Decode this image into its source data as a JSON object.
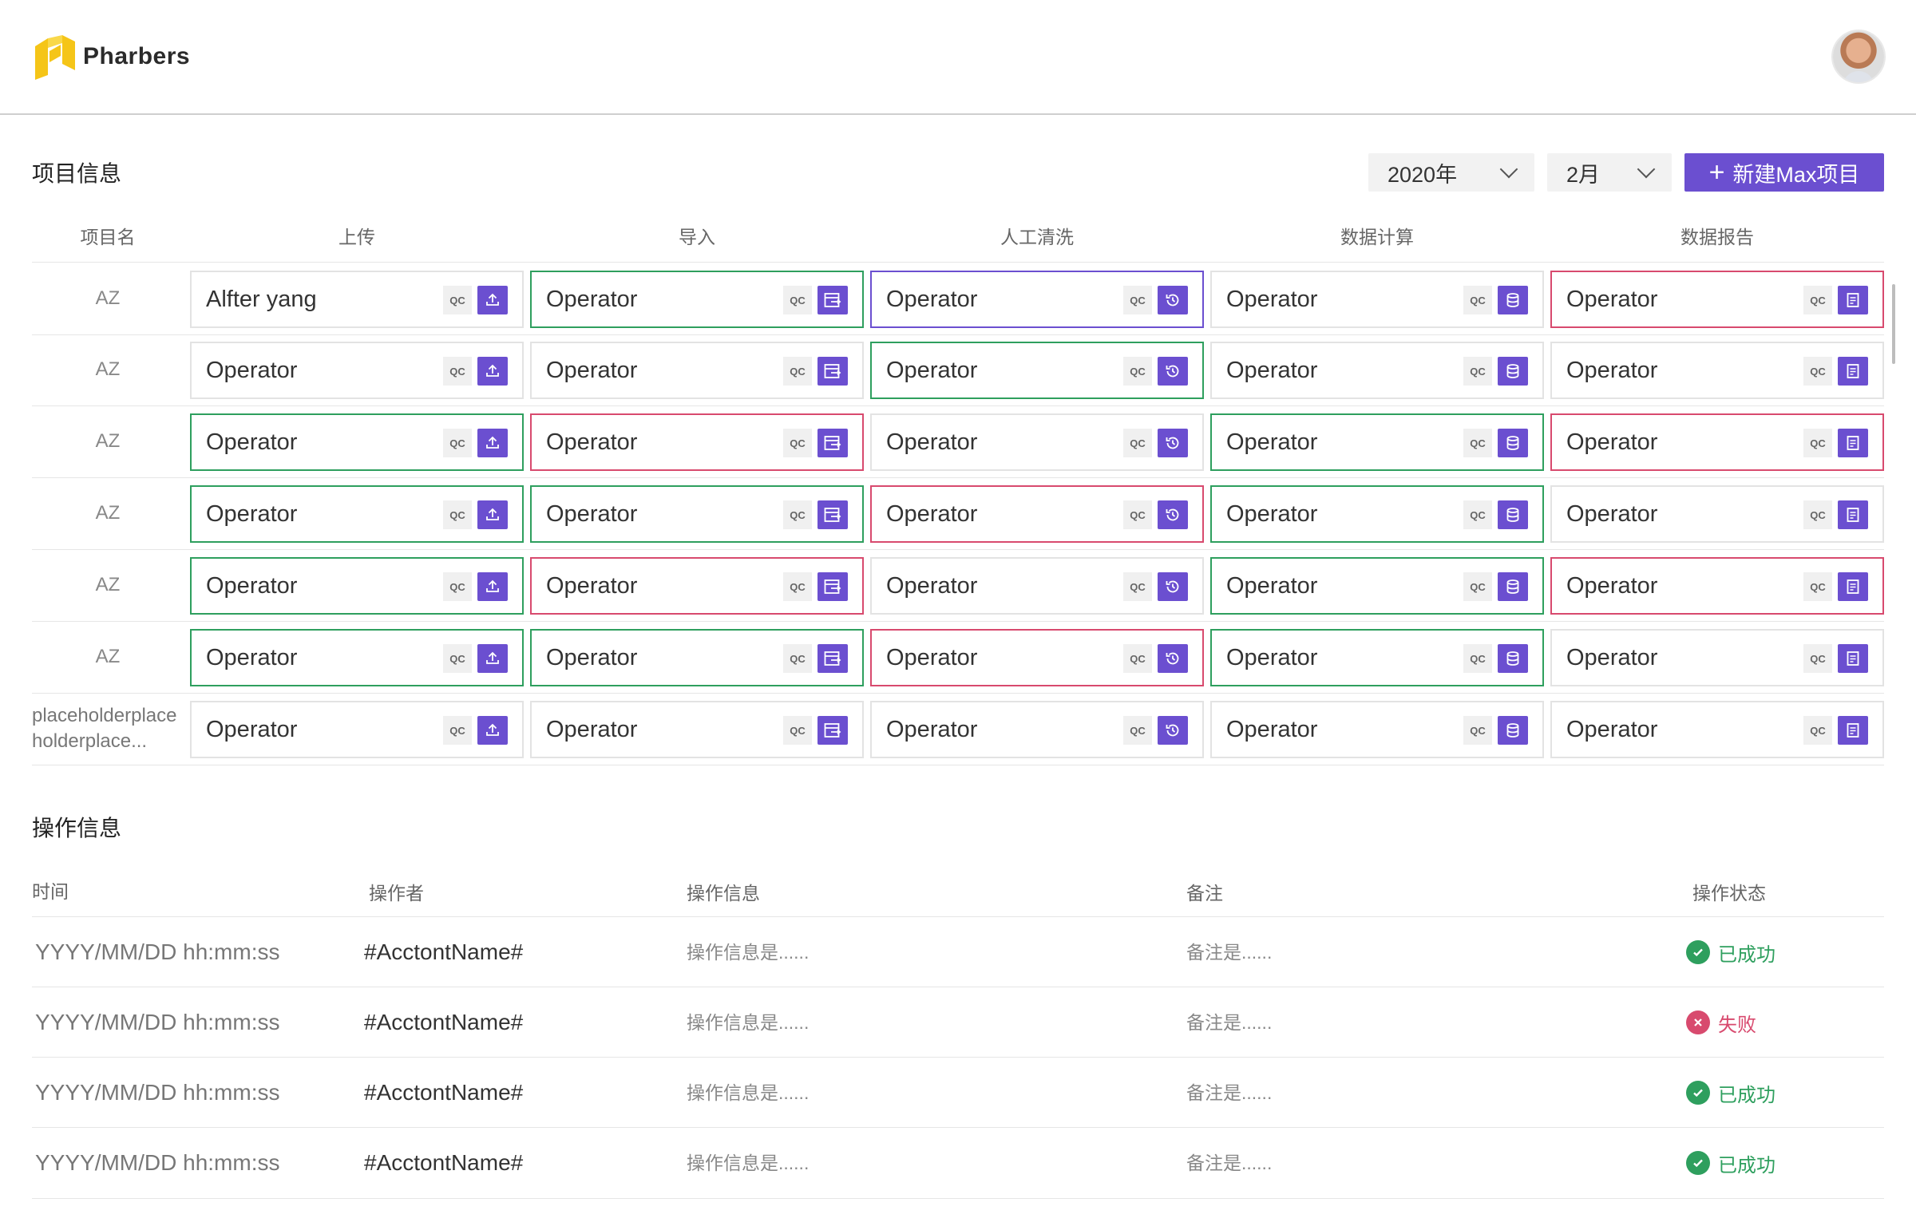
{
  "brand": {
    "name": "Pharbers"
  },
  "project_section": {
    "title": "项目信息",
    "year_select": "2020年",
    "month_select": "2月",
    "new_button": "新建Max项目",
    "qc_label": "QC",
    "columns": [
      "项目名",
      "上传",
      "导入",
      "人工清洗",
      "数据计算",
      "数据报告"
    ],
    "stage_icons": [
      "upload-icon",
      "import-icon",
      "history-icon",
      "database-icon",
      "report-icon"
    ],
    "rows": [
      {
        "name": "AZ",
        "cells": [
          {
            "label": "Alfter yang",
            "state": "default"
          },
          {
            "label": "Operator",
            "state": "green"
          },
          {
            "label": "Operator",
            "state": "purple"
          },
          {
            "label": "Operator",
            "state": "default"
          },
          {
            "label": "Operator",
            "state": "red"
          }
        ]
      },
      {
        "name": "AZ",
        "cells": [
          {
            "label": "Operator",
            "state": "default"
          },
          {
            "label": "Operator",
            "state": "default"
          },
          {
            "label": "Operator",
            "state": "green"
          },
          {
            "label": "Operator",
            "state": "default"
          },
          {
            "label": "Operator",
            "state": "default"
          }
        ]
      },
      {
        "name": "AZ",
        "cells": [
          {
            "label": "Operator",
            "state": "green"
          },
          {
            "label": "Operator",
            "state": "red"
          },
          {
            "label": "Operator",
            "state": "default"
          },
          {
            "label": "Operator",
            "state": "green"
          },
          {
            "label": "Operator",
            "state": "red"
          }
        ]
      },
      {
        "name": "AZ",
        "cells": [
          {
            "label": "Operator",
            "state": "green"
          },
          {
            "label": "Operator",
            "state": "green"
          },
          {
            "label": "Operator",
            "state": "red"
          },
          {
            "label": "Operator",
            "state": "green"
          },
          {
            "label": "Operator",
            "state": "default"
          }
        ]
      },
      {
        "name": "AZ",
        "cells": [
          {
            "label": "Operator",
            "state": "green"
          },
          {
            "label": "Operator",
            "state": "red"
          },
          {
            "label": "Operator",
            "state": "default"
          },
          {
            "label": "Operator",
            "state": "green"
          },
          {
            "label": "Operator",
            "state": "red"
          }
        ]
      },
      {
        "name": "AZ",
        "cells": [
          {
            "label": "Operator",
            "state": "green"
          },
          {
            "label": "Operator",
            "state": "green"
          },
          {
            "label": "Operator",
            "state": "red"
          },
          {
            "label": "Operator",
            "state": "green"
          },
          {
            "label": "Operator",
            "state": "default"
          }
        ]
      },
      {
        "name": "placeholderplaceholderplace...",
        "cells": [
          {
            "label": "Operator",
            "state": "default"
          },
          {
            "label": "Operator",
            "state": "default"
          },
          {
            "label": "Operator",
            "state": "default"
          },
          {
            "label": "Operator",
            "state": "default"
          },
          {
            "label": "Operator",
            "state": "default"
          }
        ]
      }
    ]
  },
  "log_section": {
    "title": "操作信息",
    "columns": [
      "时间",
      "操作者",
      "操作信息",
      "备注",
      "操作状态"
    ],
    "rows": [
      {
        "time": "YYYY/MM/DD hh:mm:ss",
        "account": "#AcctontName#",
        "info": "操作信息是......",
        "note": "备注是......",
        "status": "已成功",
        "state": "ok"
      },
      {
        "time": "YYYY/MM/DD hh:mm:ss",
        "account": "#AcctontName#",
        "info": "操作信息是......",
        "note": "备注是......",
        "status": "失败",
        "state": "fail"
      },
      {
        "time": "YYYY/MM/DD hh:mm:ss",
        "account": "#AcctontName#",
        "info": "操作信息是......",
        "note": "备注是......",
        "status": "已成功",
        "state": "ok"
      },
      {
        "time": "YYYY/MM/DD hh:mm:ss",
        "account": "#AcctontName#",
        "info": "操作信息是......",
        "note": "备注是......",
        "status": "已成功",
        "state": "ok"
      }
    ]
  },
  "colors": {
    "accent": "#6b4fd0",
    "success": "#2e9f5e",
    "danger": "#d84a6e",
    "logo_yellow": "#f5c518"
  }
}
